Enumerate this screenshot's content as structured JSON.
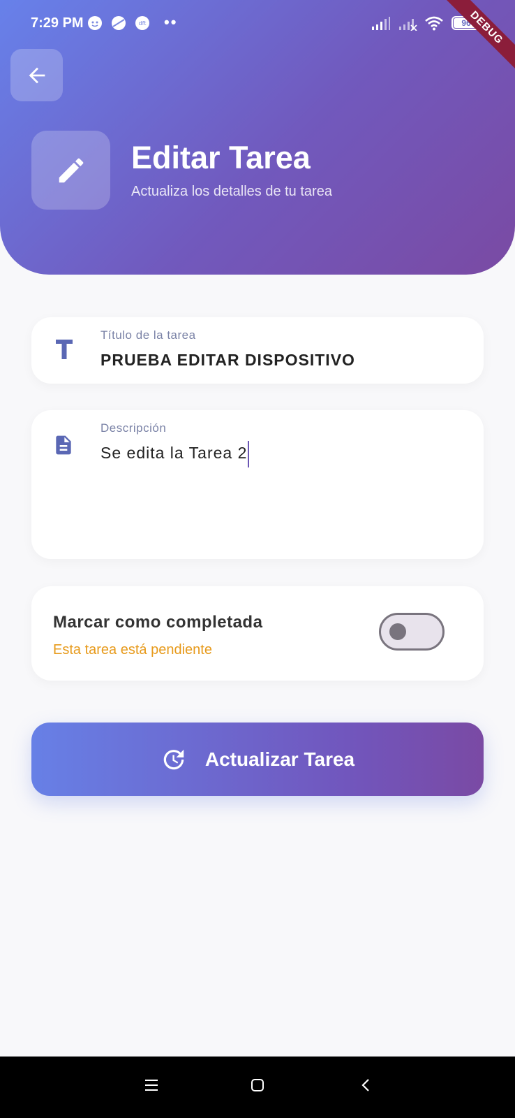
{
  "status_bar": {
    "time": "7:29 PM",
    "battery": "96",
    "dots": "••",
    "icons": [
      "face-icon",
      "planet-icon",
      "dft-badge-icon",
      "signal-icon",
      "signal-x-icon",
      "wifi-icon",
      "battery-icon"
    ]
  },
  "debug_ribbon": "DEBUG",
  "header": {
    "title": "Editar Tarea",
    "subtitle": "Actualiza los detalles de tu tarea"
  },
  "form": {
    "title_field": {
      "label": "Título de la tarea",
      "value": "PRUEBA EDITAR DISPOSITIVO"
    },
    "description_field": {
      "label": "Descripción",
      "value": "Se edita la Tarea 2"
    },
    "completed_toggle": {
      "label": "Marcar como completada",
      "status": "Esta tarea está pendiente",
      "on": false
    }
  },
  "update_button": {
    "label": "Actualizar Tarea"
  },
  "colors": {
    "header_gradient_start": "#6781ea",
    "header_gradient_end": "#7a4aa3",
    "accent": "#6a6fc4",
    "pending": "#e79a1b",
    "background": "#f8f8fa"
  }
}
